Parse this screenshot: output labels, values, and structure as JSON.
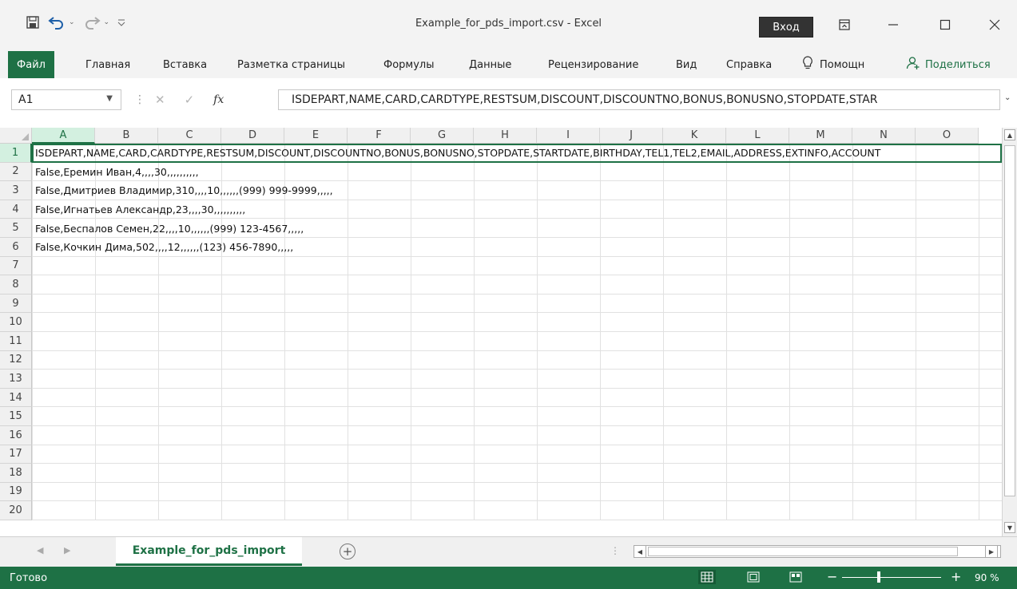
{
  "window": {
    "title": "Example_for_pds_import.csv  -  Excel",
    "signin_label": "Вход"
  },
  "ribbon": {
    "tabs": [
      {
        "label": "Файл"
      },
      {
        "label": "Главная"
      },
      {
        "label": "Вставка"
      },
      {
        "label": "Разметка страницы"
      },
      {
        "label": "Формулы"
      },
      {
        "label": "Данные"
      },
      {
        "label": "Рецензирование"
      },
      {
        "label": "Вид"
      },
      {
        "label": "Справка"
      },
      {
        "label": "Помощн"
      }
    ],
    "share_label": "Поделиться"
  },
  "formula_bar": {
    "name_box": "A1",
    "fx_label": "fx",
    "content": "ISDEPART,NAME,CARD,CARDTYPE,RESTSUM,DISCOUNT,DISCOUNTNO,BONUS,BONUSNO,STOPDATE,STAR"
  },
  "grid": {
    "columns": [
      "A",
      "B",
      "C",
      "D",
      "E",
      "F",
      "G",
      "H",
      "I",
      "J",
      "K",
      "L",
      "M",
      "N",
      "O"
    ],
    "rows": [
      {
        "num": "1",
        "text": "ISDEPART,NAME,CARD,CARDTYPE,RESTSUM,DISCOUNT,DISCOUNTNO,BONUS,BONUSNO,STOPDATE,STARTDATE,BIRTHDAY,TEL1,TEL2,EMAIL,ADDRESS,EXTINFO,ACCOUNT"
      },
      {
        "num": "2",
        "text": "False,Еремин Иван,4,,,,30,,,,,,,,,,"
      },
      {
        "num": "3",
        "text": "False,Дмитриев Владимир,310,,,,10,,,,,,(999) 999-9999,,,,,"
      },
      {
        "num": "4",
        "text": "False,Игнатьев Александр,23,,,,30,,,,,,,,,,"
      },
      {
        "num": "5",
        "text": "False,Беспалов Семен,22,,,,10,,,,,,(999) 123-4567,,,,,"
      },
      {
        "num": "6",
        "text": "False,Кочкин Дима,502,,,,12,,,,,,(123) 456-7890,,,,,"
      },
      {
        "num": "7",
        "text": ""
      },
      {
        "num": "8",
        "text": ""
      },
      {
        "num": "9",
        "text": ""
      },
      {
        "num": "10",
        "text": ""
      },
      {
        "num": "11",
        "text": ""
      },
      {
        "num": "12",
        "text": ""
      },
      {
        "num": "13",
        "text": ""
      },
      {
        "num": "14",
        "text": ""
      },
      {
        "num": "15",
        "text": ""
      },
      {
        "num": "16",
        "text": ""
      },
      {
        "num": "17",
        "text": ""
      },
      {
        "num": "18",
        "text": ""
      },
      {
        "num": "19",
        "text": ""
      },
      {
        "num": "20",
        "text": ""
      }
    ]
  },
  "sheets": {
    "active_tab": "Example_for_pds_import"
  },
  "statusbar": {
    "status": "Готово",
    "zoom": "90 %"
  },
  "colors": {
    "accent": "#1e7145",
    "selected_header": "#d3f0e0"
  }
}
